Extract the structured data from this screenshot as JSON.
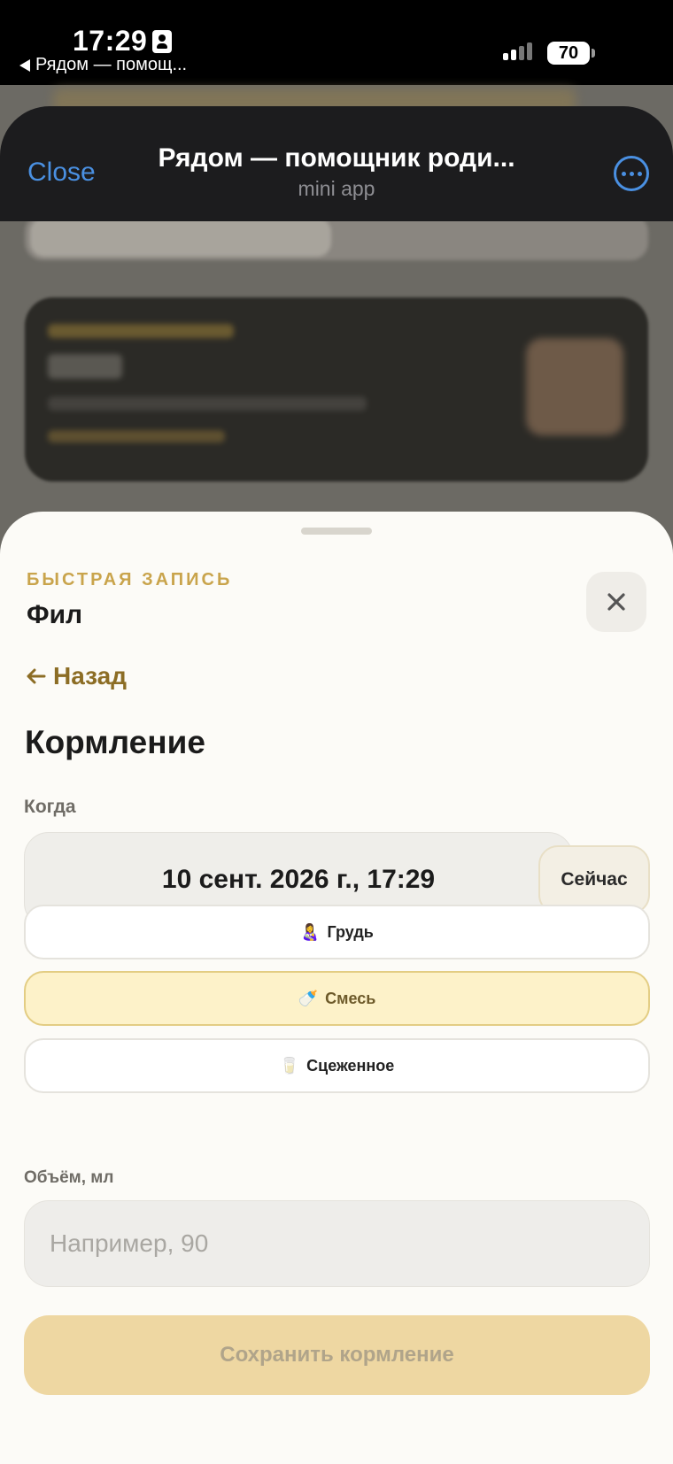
{
  "status_bar": {
    "time": "17:29",
    "back_app": "Рядом — помощ...",
    "battery": "70"
  },
  "telegram": {
    "close_label": "Close",
    "title": "Рядом — помощник роди...",
    "subtitle": "mini app"
  },
  "sheet": {
    "eyebrow": "БЫСТРАЯ ЗАПИСЬ",
    "child_name": "Фил",
    "back_label": "Назад",
    "section_title": "Кормление",
    "when_label": "Когда",
    "datetime_value": "10 сент. 2026 г., 17:29",
    "now_label": "Сейчас",
    "options": [
      {
        "icon": "👩‍🍼",
        "label": "Грудь",
        "selected": false
      },
      {
        "icon": "🍼",
        "label": "Смесь",
        "selected": true
      },
      {
        "icon": "🥛",
        "label": "Сцеженное",
        "selected": false
      }
    ],
    "volume_label": "Объём, мл",
    "volume_placeholder": "Например, 90",
    "volume_value": "",
    "save_label": "Сохранить кормление"
  },
  "colors": {
    "accent_gold": "#c9a44c",
    "link_brown": "#8c6d25",
    "selected_bg": "#fdf2c9",
    "save_bg": "#eed7a2",
    "tg_blue": "#4a90e2"
  }
}
